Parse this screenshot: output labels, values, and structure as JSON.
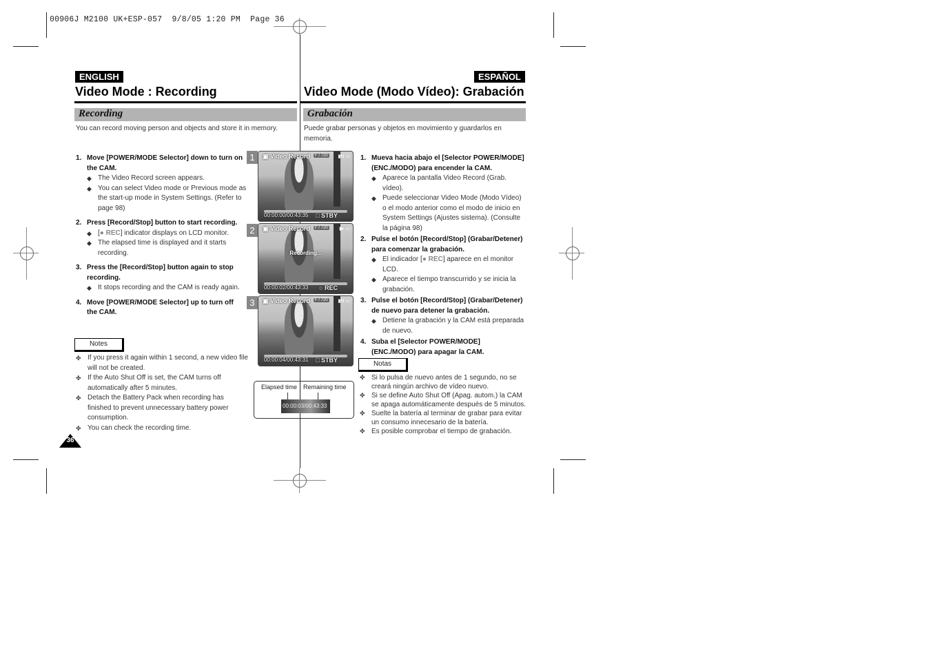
{
  "print_header": "00906J M2100 UK+ESP-057  9/8/05 1:20 PM  Page 36",
  "english": {
    "lang_label": "ENGLISH",
    "title": "Video Mode : Recording",
    "section": "Recording",
    "intro": "You can record moving person and objects and store it in memory.",
    "steps": [
      {
        "num": "1.",
        "text": "Move [POWER/MODE Selector] down to turn on the CAM.",
        "bullets": [
          "The Video Record screen appears.",
          "You can select Video mode or Previous mode as the start-up mode in System Settings. (Refer to page 98)"
        ]
      },
      {
        "num": "2.",
        "text": "Press [Record/Stop] button to start recording.",
        "bullets_rec": {
          "pre": "[",
          "rec": "● REC",
          "post": "] indicator displays on LCD monitor."
        },
        "bullets": [
          "The elapsed time is displayed and it starts recording."
        ]
      },
      {
        "num": "3.",
        "text": "Press the [Record/Stop] button again to stop recording.",
        "bullets": [
          "It stops recording and the CAM is ready again."
        ]
      },
      {
        "num": "4.",
        "text": "Move [POWER/MODE Selector] up to turn off the CAM.",
        "bullets": []
      }
    ],
    "notes_label": "Notes",
    "notes": [
      "If you press it again within 1 second, a new video file will not be created.",
      "If the Auto Shut Off is set, the CAM turns off automatically after 5 minutes.",
      "Detach the Battery Pack when recording has finished to prevent unnecessary battery power consumption.",
      "You can check the recording time."
    ],
    "page_number": "36"
  },
  "espanol": {
    "lang_label": "ESPAÑOL",
    "title": "Video Mode (Modo Vídeo): Grabación",
    "section": "Grabación",
    "intro": "Puede grabar personas y objetos en movimiento y guardarlos en memoria.",
    "steps": [
      {
        "num": "1.",
        "text": "Mueva hacia abajo el [Selector POWER/MODE] (ENC./MODO) para encender la CAM.",
        "bullets": [
          "Aparece la pantalla Video Record (Grab. vídeo).",
          "Puede seleccionar Video Mode (Modo Vídeo) o el modo anterior como el modo de inicio en System Settings (Ajustes sistema). (Consulte la página 98)"
        ]
      },
      {
        "num": "2.",
        "text": "Pulse el botón [Record/Stop] (Grabar/Detener) para comenzar la grabación.",
        "bullets_rec": {
          "pre": "El indicador [",
          "rec": "● REC",
          "post": "] aparece en el monitor LCD."
        },
        "bullets": [
          "Aparece el tiempo transcurrido y se inicia la grabación."
        ]
      },
      {
        "num": "3.",
        "text": "Pulse el botón [Record/Stop] (Grabar/Detener) de nuevo para detener la grabación.",
        "bullets": [
          "Detiene la grabación y la CAM está preparada de nuevo."
        ]
      },
      {
        "num": "4.",
        "text": "Suba el [Selector POWER/MODE] (ENC./MODO) para apagar la CAM.",
        "bullets": []
      }
    ],
    "notes_label": "Notas",
    "notes": [
      "Si lo pulsa de nuevo antes de 1 segundo, no se creará ningún archivo de vídeo nuevo.",
      "Si se define Auto Shut Off (Apag. autom.) la CAM se apaga automáticamente después de 5 minutos.",
      "Suelte la batería al terminar de grabar para evitar un consumo innecesario de la batería.",
      "Es posible comprobar el tiempo de grabación."
    ]
  },
  "screenshots": [
    {
      "step": "1",
      "title": "Video Record",
      "badge": "F / 720",
      "status": "00:00:00/00:43:35",
      "mode": "STBY",
      "center": ""
    },
    {
      "step": "2",
      "title": "Video Record",
      "badge": "F / 720",
      "status": "00:00:02/00:43:33",
      "mode": "REC",
      "center": "Recording..."
    },
    {
      "step": "3",
      "title": "Video Record",
      "badge": "F / 720",
      "status": "00:00:04/00:43:31",
      "mode": "STBY",
      "center": ""
    }
  ],
  "time_box": {
    "elapsed_label": "Elapsed time",
    "remaining_label": "Remaining time",
    "readout": "00:00:03/00:43:33"
  },
  "symbols": {
    "diamond": "◆",
    "clover": "✤"
  }
}
